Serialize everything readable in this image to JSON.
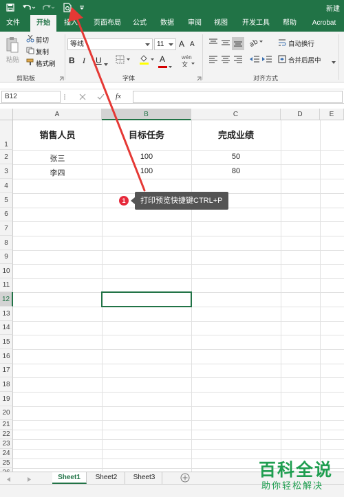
{
  "window": {
    "title_fragment": "新建"
  },
  "tabs": [
    "文件",
    "开始",
    "插入",
    "页面布局",
    "公式",
    "数据",
    "审阅",
    "视图",
    "开发工具",
    "帮助",
    "Acrobat"
  ],
  "ribbon": {
    "clipboard": {
      "paste": "粘贴",
      "cut": "剪切",
      "copy": "复制",
      "format_painter": "格式刷",
      "label": "剪贴板"
    },
    "font": {
      "name": "等线",
      "size": "11",
      "grow": "A",
      "shrink": "A",
      "bold": "B",
      "italic": "I",
      "underline": "U",
      "color_letter": "A",
      "phonetic": "wén",
      "label": "字体"
    },
    "alignment": {
      "wrap": "自动换行",
      "merge": "合并后居中",
      "label": "对齐方式"
    }
  },
  "formula_bar": {
    "name_box": "B12",
    "fx": "fx",
    "value": ""
  },
  "columns": [
    "A",
    "B",
    "C",
    "D",
    "E"
  ],
  "rows": [
    "1",
    "2",
    "3",
    "4",
    "5",
    "6",
    "7",
    "8",
    "9",
    "10",
    "11",
    "12",
    "13",
    "14",
    "15",
    "16",
    "17",
    "18",
    "19",
    "20",
    "21",
    "22",
    "23",
    "24",
    "25",
    "26"
  ],
  "table": {
    "headers": [
      "销售人员",
      "目标任务",
      "完成业绩"
    ],
    "rows": [
      [
        "张三",
        "100",
        "50"
      ],
      [
        "李四",
        "100",
        "80"
      ]
    ]
  },
  "callout": {
    "badge": "1",
    "text": "打印预览快捷键CTRL+P"
  },
  "sheets": [
    "Sheet1",
    "Sheet2",
    "Sheet3"
  ],
  "watermark": {
    "top": "百科全说",
    "bottom": "助你轻松解决"
  },
  "colors": {
    "excel_green": "#217346",
    "callout_bg": "#545454",
    "badge_red": "#e6293b",
    "arrow_red": "#e53935",
    "watermark_green": "#1f9e50"
  }
}
